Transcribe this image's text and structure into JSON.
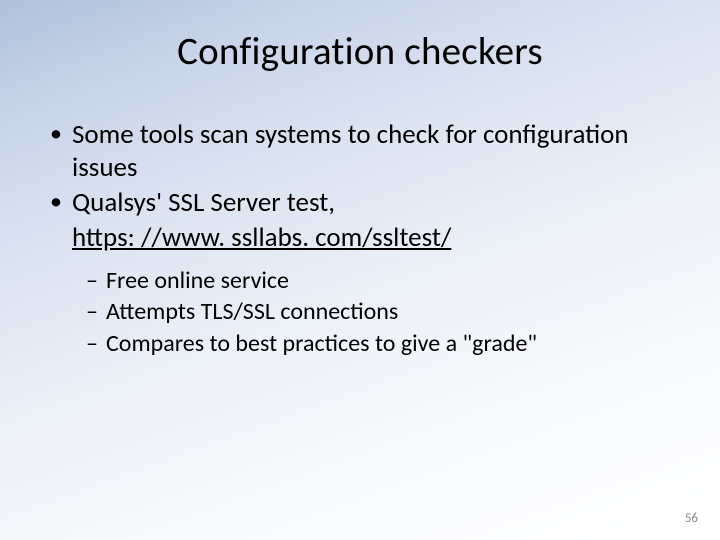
{
  "title": "Configuration checkers",
  "bullets": {
    "b0": "Some tools scan systems to check for configuration issues",
    "b1_prefix": "Qualsys' SSL Server test, ",
    "b1_link": "https: //www. ssllabs. com/ssltest/"
  },
  "sub": {
    "s0": "Free online service",
    "s1": "Attempts TLS/SSL connections",
    "s2": "Compares to best practices to give a \"grade\""
  },
  "page": "56"
}
